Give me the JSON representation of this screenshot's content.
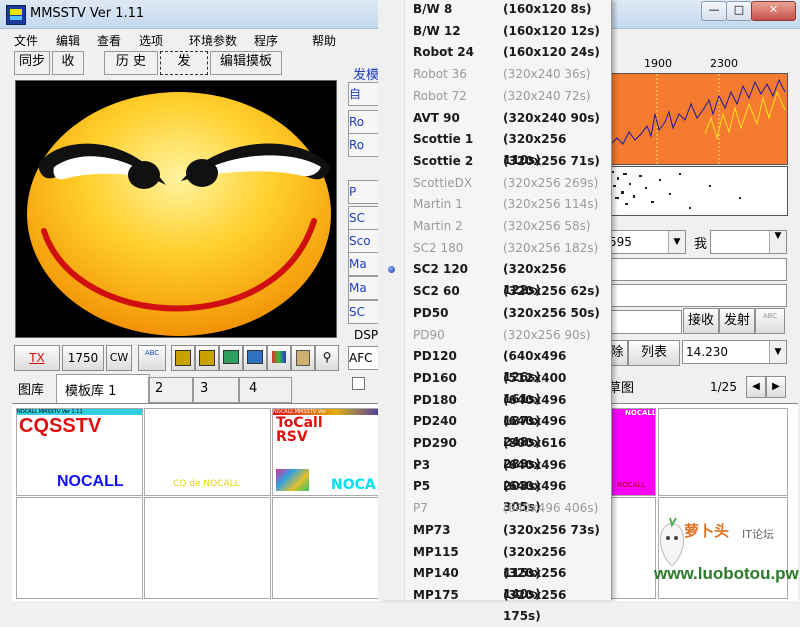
{
  "window": {
    "title": "MMSSTV Ver 1.11"
  },
  "menu": [
    "文件",
    "编辑",
    "查看",
    "选项",
    "环境参数",
    "程序",
    "帮助"
  ],
  "tabs": {
    "sync": "同步",
    "recv": "收",
    "history": "历 史",
    "send": "发",
    "edit_template": "编辑摸板"
  },
  "side_buttons": {
    "send_label": "发模",
    "auto": "自",
    "ro1": "Ro",
    "ro2": "Ro",
    "p": "P",
    "sc1": "SC",
    "sco": "Sco",
    "ma1": "Ma",
    "ma2": "Ma",
    "sc2": "SC",
    "dsp": "DSP",
    "afc": "AFC"
  },
  "toolbar": {
    "tx": "TX",
    "tone": "1750",
    "cw": "CW",
    "abc": "ABC"
  },
  "bottom_tabs": {
    "gallery": "图库",
    "template1": "模板库 1",
    "t2": "2",
    "t3": "3",
    "t4": "4"
  },
  "templates": {
    "t1_header": "NOCALL      MMSSTV Ver 1.11",
    "t1_title": "CQSSTV",
    "t1_call": "NOCALL",
    "t2_text": "CQ de NOCALL",
    "t3_header": "NOCALL         MMSSTV Ver",
    "t3_line1": "ToCall",
    "t3_line2": "RSV",
    "t3_call": "NOCA",
    "t4_header": "NOCALL",
    "t4_footer": "NOCALL"
  },
  "right_panel": {
    "freq_labels": [
      "1900",
      "2300"
    ],
    "value_595": "595",
    "label_me": "我",
    "recv_btn": "接收",
    "send_btn": "发射",
    "abc": "ABC",
    "delete_label": "除",
    "list_btn": "列表",
    "freq_value": "14.230",
    "draft": "草图",
    "page": "1/25"
  },
  "mode_menu": [
    {
      "name": "B/W 8",
      "res": "(160x120 8s)",
      "enabled": true
    },
    {
      "name": "B/W 12",
      "res": "(160x120 12s)",
      "enabled": true
    },
    {
      "name": "Robot 24",
      "res": "(160x120 24s)",
      "enabled": true
    },
    {
      "name": "Robot 36",
      "res": "(320x240 36s)",
      "enabled": false
    },
    {
      "name": "Robot 72",
      "res": "(320x240 72s)",
      "enabled": false
    },
    {
      "name": "AVT 90",
      "res": "(320x240 90s)",
      "enabled": true
    },
    {
      "name": "Scottie 1",
      "res": "(320x256 110s)",
      "enabled": true
    },
    {
      "name": "Scottie 2",
      "res": "(320x256 71s)",
      "enabled": true
    },
    {
      "name": "ScottieDX",
      "res": "(320x256 269s)",
      "enabled": false
    },
    {
      "name": "Martin 1",
      "res": "(320x256 114s)",
      "enabled": false
    },
    {
      "name": "Martin 2",
      "res": "(320x256 58s)",
      "enabled": false
    },
    {
      "name": "SC2 180",
      "res": "(320x256 182s)",
      "enabled": false
    },
    {
      "name": "SC2 120",
      "res": "(320x256 122s)",
      "enabled": true,
      "selected": true
    },
    {
      "name": "SC2 60",
      "res": "(320x256 62s)",
      "enabled": true
    },
    {
      "name": "PD50",
      "res": "(320x256 50s)",
      "enabled": true
    },
    {
      "name": "PD90",
      "res": "(320x256 90s)",
      "enabled": false
    },
    {
      "name": "PD120",
      "res": "(640x496 126s)",
      "enabled": true
    },
    {
      "name": "PD160",
      "res": "(512x400 161s)",
      "enabled": true
    },
    {
      "name": "PD180",
      "res": "(640x496 187s)",
      "enabled": true
    },
    {
      "name": "PD240",
      "res": "(640x496 248s)",
      "enabled": true
    },
    {
      "name": "PD290",
      "res": "(800x616 289s)",
      "enabled": true
    },
    {
      "name": "P3",
      "res": "(640x496 203s)",
      "enabled": true
    },
    {
      "name": "P5",
      "res": "(640x496 305s)",
      "enabled": true
    },
    {
      "name": "P7",
      "res": "(640x496 406s)",
      "enabled": false
    },
    {
      "name": "MP73",
      "res": "(320x256 73s)",
      "enabled": true
    },
    {
      "name": "MP115",
      "res": "(320x256 115s)",
      "enabled": true
    },
    {
      "name": "MP140",
      "res": "(320x256 140s)",
      "enabled": true
    },
    {
      "name": "MP175",
      "res": "(320x256 175s)",
      "enabled": true
    }
  ],
  "watermark": {
    "brand": "萝卜头",
    "sub": "IT论坛",
    "url": "www.luobotou.pw"
  },
  "colors": {
    "spectrum_bg": "#f47a30",
    "template_blue": "#1010ff",
    "template_red": "#e01010",
    "template_magenta": "#ff00ff"
  }
}
